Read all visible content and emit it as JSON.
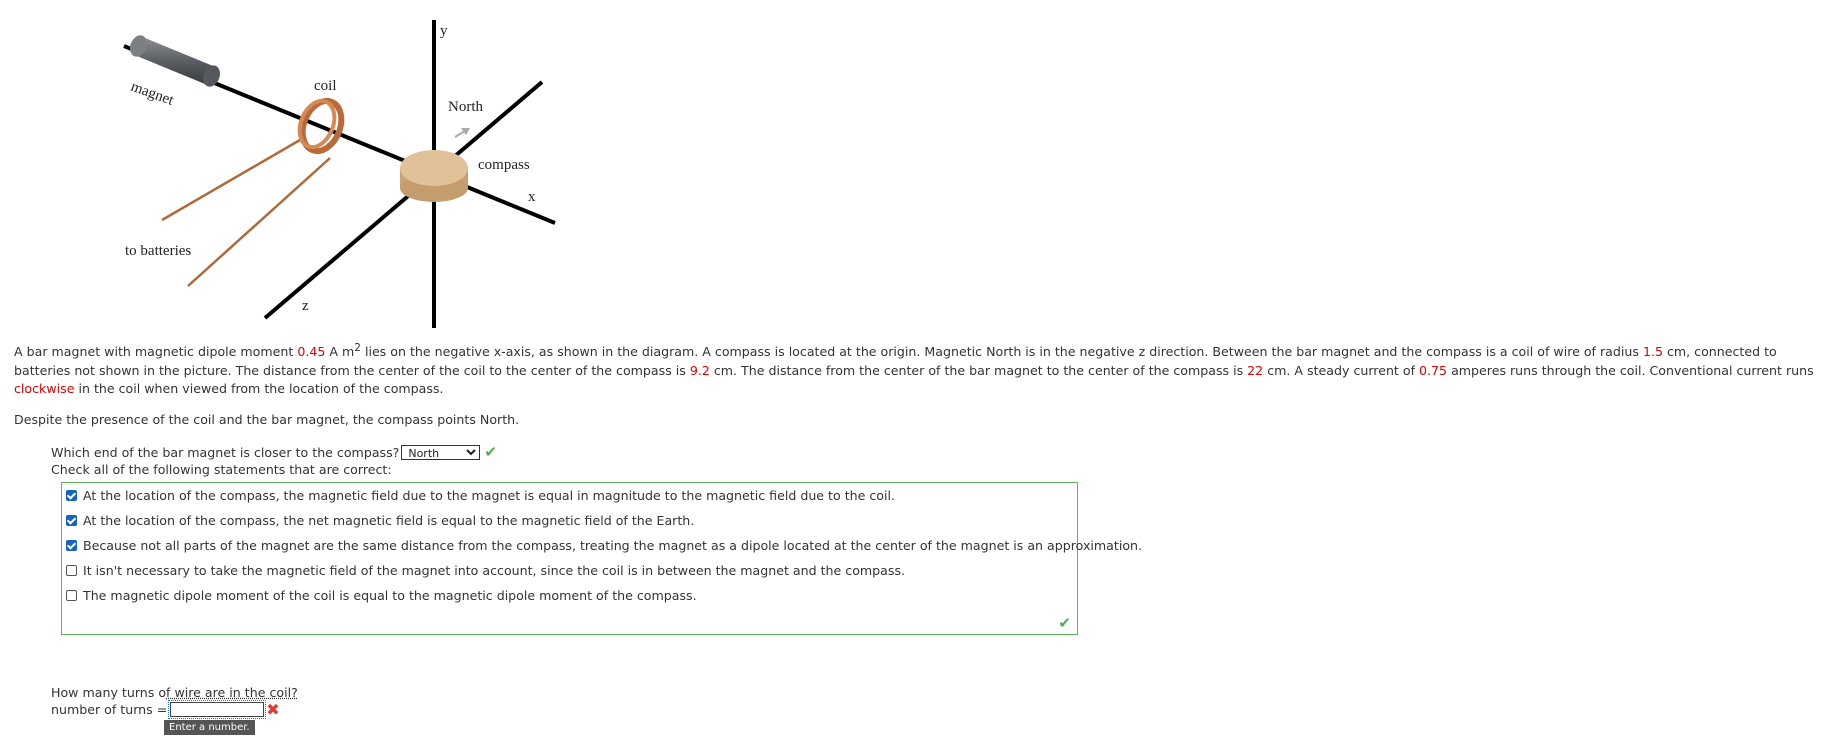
{
  "diagram": {
    "labels": {
      "magnet": "magnet",
      "coil": "coil",
      "y": "y",
      "north": "North",
      "compass": "compass",
      "x": "x",
      "to_batteries": "to batteries",
      "z": "z"
    }
  },
  "problem": {
    "s1": "A bar magnet with magnetic dipole moment ",
    "moment": "0.45",
    "s2": " A m",
    "s2_sup": "2",
    "s3": " lies on the negative x-axis, as shown in the diagram. A compass is located at the origin. Magnetic North is in the negative z direction. Between the bar magnet and the compass is a coil of wire of radius ",
    "radius": "1.5",
    "s4": " cm, connected to batteries not shown in the picture. The distance from the center of the coil to the center of the compass is ",
    "coil_distance": "9.2",
    "s5": " cm. The distance from the center of the bar magnet to the center of the compass is ",
    "magnet_distance": "22",
    "s6": " cm. A steady current of ",
    "current": "0.75",
    "s7": " amperes runs through the coil. Conventional current runs ",
    "direction": "clockwise",
    "s8": " in the coil when viewed from the location of the compass.",
    "p2": "Despite the presence of the coil and the bar magnet, the compass points North."
  },
  "q1": {
    "text": "Which end of the bar magnet is closer to the compass?",
    "selected": "North",
    "status": "✔"
  },
  "q2": {
    "text": "Check all of the following statements that are correct:",
    "options": [
      {
        "label": "At the location of the compass, the magnetic field due to the magnet is equal in magnitude to the magnetic field due to the coil.",
        "checked": true
      },
      {
        "label": "At the location of the compass, the net magnetic field is equal to the magnetic field of the Earth.",
        "checked": true
      },
      {
        "label": "Because not all parts of the magnet are the same distance from the compass, treating the magnet as a dipole located at the center of the magnet is an approximation.",
        "checked": true
      },
      {
        "label": "It isn't necessary to take the magnetic field of the magnet into account, since the coil is in between the magnet and the compass.",
        "checked": false
      },
      {
        "label": "The magnetic dipole moment of the coil is equal to the magnetic dipole moment of the compass.",
        "checked": false
      }
    ],
    "status": "✔"
  },
  "q3": {
    "text_a": "How many turns o",
    "text_b": "f wire are in the coil?",
    "input_label": "number of turns =",
    "input_value": "",
    "status": "✖",
    "tooltip": "Enter a number."
  },
  "colors": {
    "accent_green": "#4caf50",
    "error_red": "#e53935",
    "highlight_red": "#e00000",
    "checkbox_blue": "#1565c0"
  }
}
